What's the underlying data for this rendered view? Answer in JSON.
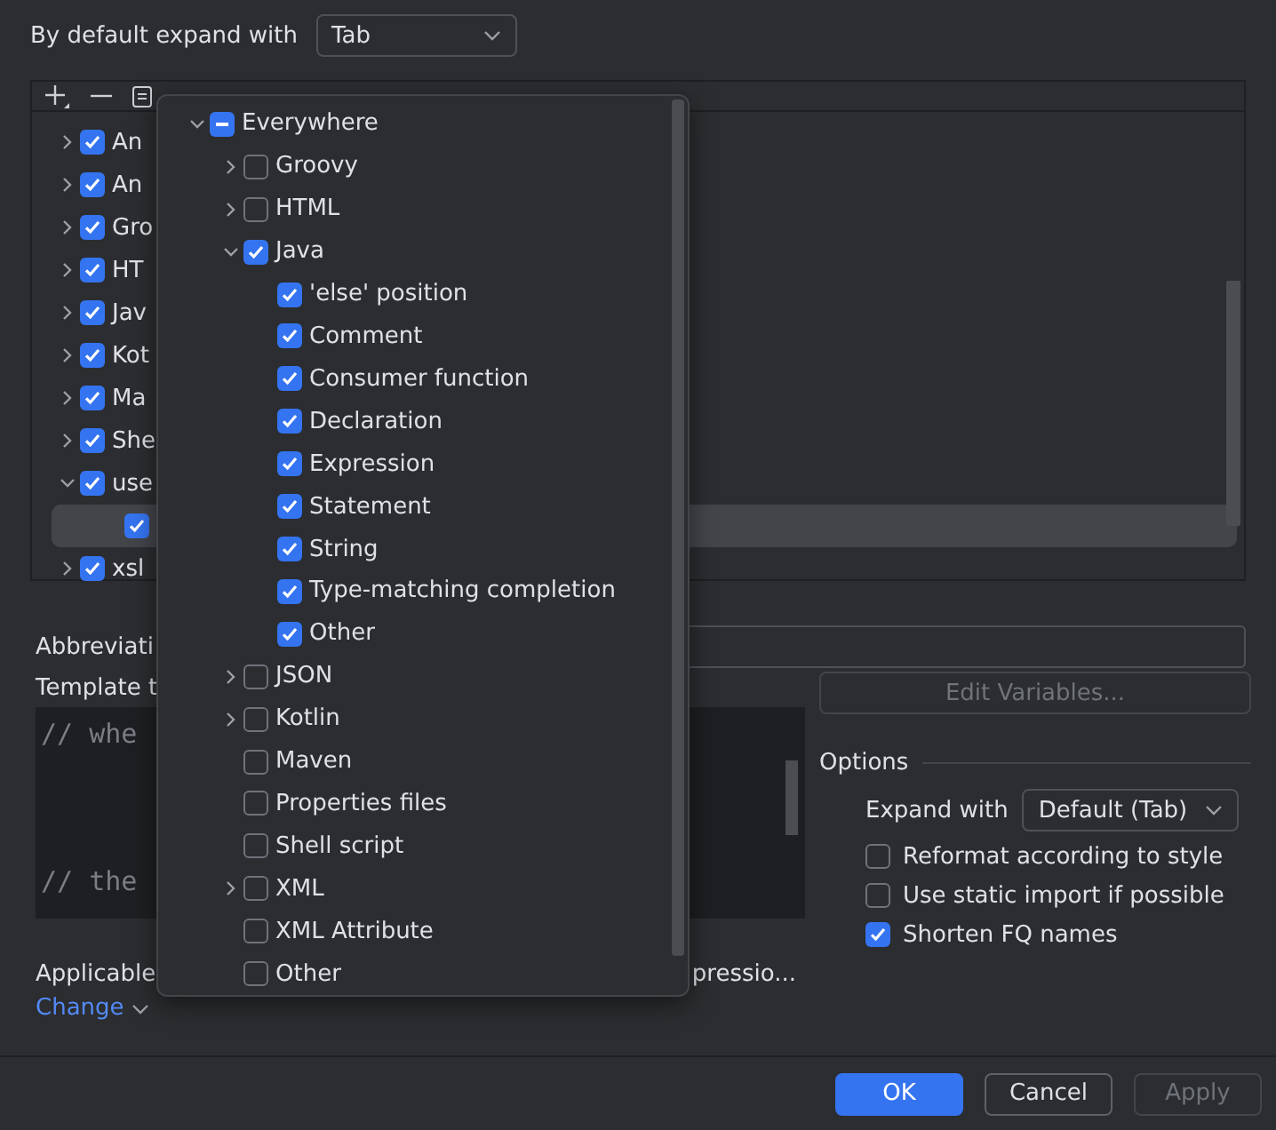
{
  "expand_default": {
    "label": "By default expand with",
    "value": "Tab"
  },
  "template_groups": [
    {
      "label": "An",
      "checked": true,
      "expanded": false,
      "selected": false
    },
    {
      "label": "An",
      "checked": true,
      "expanded": false,
      "selected": false
    },
    {
      "label": "Gro",
      "checked": true,
      "expanded": false,
      "selected": false
    },
    {
      "label": "HT",
      "checked": true,
      "expanded": false,
      "selected": false
    },
    {
      "label": "Jav",
      "checked": true,
      "expanded": false,
      "selected": false
    },
    {
      "label": "Kot",
      "checked": true,
      "expanded": false,
      "selected": false
    },
    {
      "label": "Ma",
      "checked": true,
      "expanded": false,
      "selected": false
    },
    {
      "label": "She",
      "checked": true,
      "expanded": false,
      "selected": false
    },
    {
      "label": "use",
      "checked": true,
      "expanded": true,
      "selected": false,
      "children": [
        {
          "checked": true,
          "selected": true
        }
      ]
    },
    {
      "label": "xsl",
      "checked": true,
      "expanded": false,
      "selected": false
    }
  ],
  "context_popup": {
    "items": [
      {
        "label": "Everywhere",
        "checked": false,
        "partial": true,
        "expanded": true,
        "children": [
          {
            "label": "Groovy",
            "checked": false,
            "expanded": false
          },
          {
            "label": "HTML",
            "checked": false,
            "expanded": false
          },
          {
            "label": "Java",
            "checked": true,
            "expanded": true,
            "children": [
              {
                "label": "'else' position",
                "checked": true
              },
              {
                "label": "Comment",
                "checked": true
              },
              {
                "label": "Consumer function",
                "checked": true
              },
              {
                "label": "Declaration",
                "checked": true
              },
              {
                "label": "Expression",
                "checked": true
              },
              {
                "label": "Statement",
                "checked": true
              },
              {
                "label": "String",
                "checked": true
              },
              {
                "label": "Type-matching completion",
                "checked": true
              },
              {
                "label": "Other",
                "checked": true
              }
            ]
          },
          {
            "label": "JSON",
            "checked": false,
            "expanded": false
          },
          {
            "label": "Kotlin",
            "checked": false,
            "expanded": false
          },
          {
            "label": "Maven",
            "checked": false
          },
          {
            "label": "Properties files",
            "checked": false
          },
          {
            "label": "Shell script",
            "checked": false
          },
          {
            "label": "XML",
            "checked": false,
            "expanded": false
          },
          {
            "label": "XML Attribute",
            "checked": false
          },
          {
            "label": "Other",
            "checked": false
          }
        ]
      }
    ]
  },
  "abbreviation": {
    "label": "Abbreviati"
  },
  "template": {
    "label": "Template t",
    "lines": [
      "// whe",
      "// the"
    ]
  },
  "edit_variables": {
    "label": "Edit Variables...",
    "disabled": true
  },
  "options": {
    "title": "Options",
    "expand_with": {
      "label": "Expand with",
      "value": "Default (Tab)"
    },
    "checkboxes": [
      {
        "label": "Reformat according to style",
        "checked": false
      },
      {
        "label": "Use static import if possible",
        "checked": false
      },
      {
        "label": "Shorten FQ names",
        "checked": true
      }
    ]
  },
  "applicable": {
    "label": "Applicable",
    "suffix": "pressio...",
    "link": "Change"
  },
  "buttons": [
    {
      "label": "OK",
      "kind": "primary"
    },
    {
      "label": "Cancel",
      "kind": "normal"
    },
    {
      "label": "Apply",
      "kind": "disabled"
    }
  ]
}
